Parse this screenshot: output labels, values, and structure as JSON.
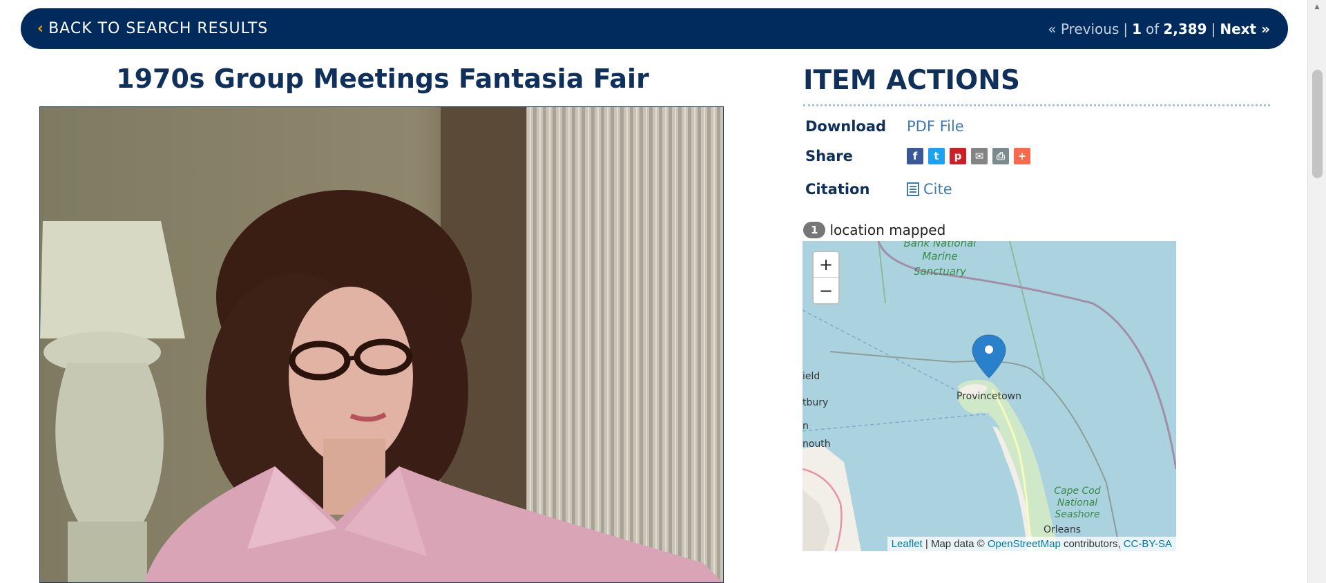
{
  "topbar": {
    "back_label": "BACK TO SEARCH RESULTS",
    "prev_label": "« Previous",
    "separator": "|",
    "current": "1",
    "of_label": "of",
    "total": "2,389",
    "next_label": "Next »"
  },
  "item": {
    "title": "1970s Group Meetings Fantasia Fair"
  },
  "actions": {
    "heading": "ITEM ACTIONS",
    "download_label": "Download",
    "download_value": "PDF File",
    "share_label": "Share",
    "share_icons": [
      {
        "name": "facebook-icon",
        "glyph": "f",
        "color": "#3b5998"
      },
      {
        "name": "twitter-icon",
        "glyph": "t",
        "color": "#1da1f2"
      },
      {
        "name": "pinterest-icon",
        "glyph": "p",
        "color": "#cb2027"
      },
      {
        "name": "email-icon",
        "glyph": "✉",
        "color": "#848484"
      },
      {
        "name": "print-icon",
        "glyph": "⎙",
        "color": "#7d8a8d"
      },
      {
        "name": "more-icon",
        "glyph": "+",
        "color": "#f8694d"
      }
    ],
    "citation_label": "Citation",
    "cite_label": "Cite"
  },
  "map": {
    "count": "1",
    "count_label": "location mapped",
    "zoom_in": "+",
    "zoom_out": "−",
    "labels": {
      "sanctuary_1": "Bank National",
      "sanctuary_2": "Marine",
      "sanctuary_3": "Sanctuary",
      "provincetown": "Provincetown",
      "seashore_1": "Cape Cod",
      "seashore_2": "National",
      "seashore_3": "Seashore",
      "orleans": "Orleans",
      "left_1": "ield",
      "left_2": "tbury",
      "left_3": "n",
      "left_4": "nouth"
    },
    "attribution": {
      "leaflet": "Leaflet",
      "map_data": "| Map data ©",
      "osm": "OpenStreetMap",
      "contributors": "contributors,",
      "license": "CC-BY-SA"
    }
  }
}
